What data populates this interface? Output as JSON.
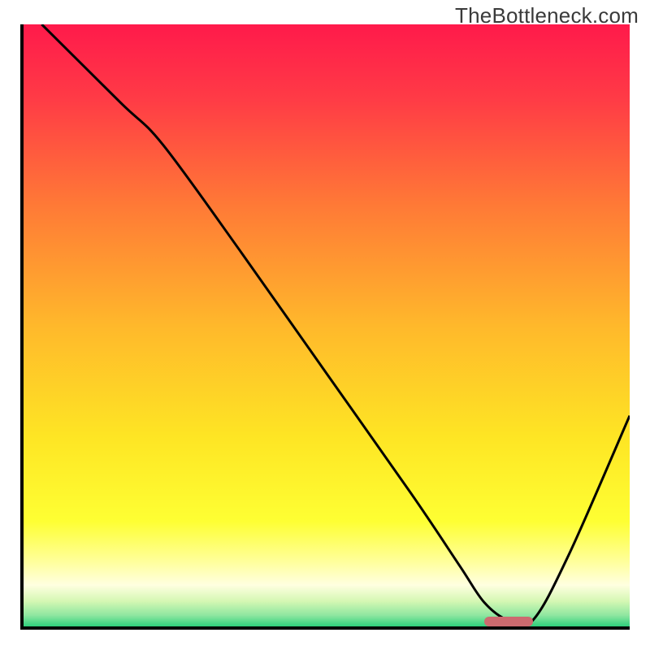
{
  "watermark": "TheBottleneck.com",
  "chart_data": {
    "type": "line",
    "title": "",
    "xlabel": "",
    "ylabel": "",
    "xlim": [
      0,
      100
    ],
    "ylim": [
      0,
      100
    ],
    "grid": false,
    "legend": false,
    "gradient_stops": [
      {
        "t": 0.0,
        "color": "#ff1a4b"
      },
      {
        "t": 0.12,
        "color": "#ff3a46"
      },
      {
        "t": 0.3,
        "color": "#ff7a36"
      },
      {
        "t": 0.5,
        "color": "#ffb92b"
      },
      {
        "t": 0.68,
        "color": "#fee524"
      },
      {
        "t": 0.82,
        "color": "#feff33"
      },
      {
        "t": 0.885,
        "color": "#ffff99"
      },
      {
        "t": 0.925,
        "color": "#ffffe0"
      },
      {
        "t": 0.952,
        "color": "#d4f7b3"
      },
      {
        "t": 0.975,
        "color": "#8ee6a0"
      },
      {
        "t": 0.992,
        "color": "#34d17e"
      },
      {
        "t": 1.0,
        "color": "#1fb872"
      }
    ],
    "series": [
      {
        "name": "bottleneck-curve",
        "x": [
          3,
          16,
          23,
          36,
          50,
          64,
          72,
          76,
          80,
          84,
          90,
          100
        ],
        "values": [
          100,
          87,
          80,
          62,
          42,
          22,
          10,
          4,
          1,
          1,
          12,
          35
        ]
      }
    ],
    "annotations": [
      {
        "name": "optimal-range-marker",
        "type": "h-bar",
        "x_start": 76,
        "x_end": 84,
        "y": 0.5,
        "color": "#cd6a6f"
      }
    ]
  }
}
